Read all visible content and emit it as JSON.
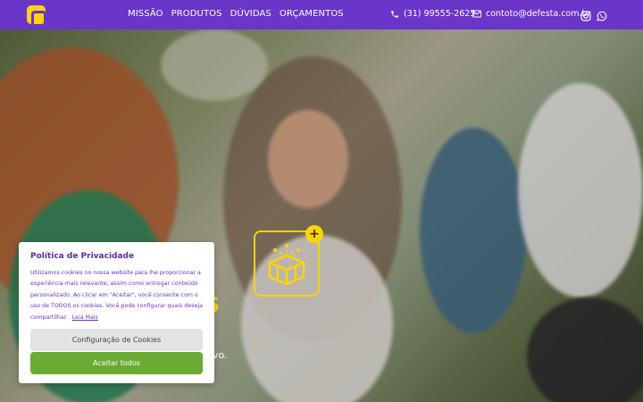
{
  "brand": {
    "logo_icon": "logo-mark"
  },
  "nav": {
    "items": [
      {
        "label": "MISSÃO"
      },
      {
        "label": "PRODUTOS"
      },
      {
        "label": "DÚVIDAS"
      },
      {
        "label": "ORÇAMENTOS"
      }
    ]
  },
  "contact": {
    "phone": "(31) 99555-2625",
    "email": "contoto@defesta.com.br"
  },
  "hero": {
    "headline_fragment": "s",
    "subtitle_fragment": "vo."
  },
  "cookie": {
    "title": "Política de Privacidade",
    "body": "Utilizamos cookies no nossa website para lhe proporcionar a experiência mais relevante, assim como entregar conteúdo personalizado. Ao clicar em \"Aceitar\", você consente com o uso de TODOS os cookies. Você pode configurar quais deseja compartilhar.",
    "read_more": "Leia Mais",
    "config_button": "Configuração de Cookies",
    "accept_button": "Aceitar todos"
  },
  "colors": {
    "primary": "#6a35c9",
    "accent": "#ffd400",
    "accept": "#6aab34"
  }
}
